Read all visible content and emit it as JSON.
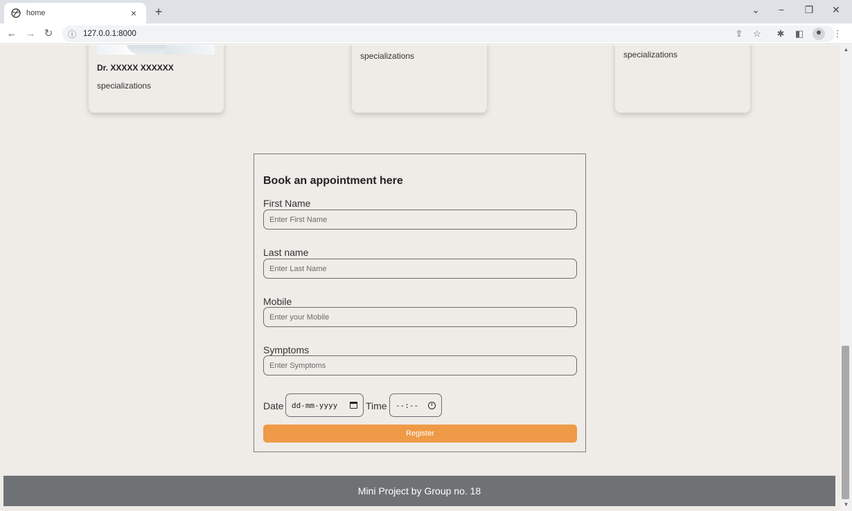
{
  "browser": {
    "tab_title": "home",
    "tab_close": "×",
    "new_tab": "+",
    "url": "127.0.0.1:8000",
    "icons": [
      "globe-icon",
      "back-icon",
      "forward-icon",
      "reload-icon",
      "info-icon",
      "share-icon",
      "star-icon",
      "extensions-icon",
      "side-panel-icon",
      "profile-icon",
      "menu-icon"
    ],
    "window_controls": {
      "dropdown": "⌄",
      "minimize": "−",
      "restore": "❐",
      "close": "✕"
    }
  },
  "doctors": [
    {
      "name": "Dr. XXXXX XXXXXX",
      "specialization": "specializations"
    },
    {
      "specialization": "specializations"
    },
    {
      "specialization": "specializations"
    }
  ],
  "appointment_form": {
    "title": "Book an appointment here",
    "fields": [
      {
        "label": "First Name",
        "placeholder": "Enter First Name"
      },
      {
        "label": "Last name",
        "placeholder": "Enter Last Name"
      },
      {
        "label": "Mobile",
        "placeholder": "Enter your Mobile"
      },
      {
        "label": "Symptoms",
        "placeholder": "Enter Symptoms"
      }
    ],
    "date_label": "Date",
    "date_placeholder": "dd-mm-yyyy",
    "time_label": "Time",
    "time_placeholder": "--:--",
    "submit_label": "Register",
    "accent_color": "#ee9a47"
  },
  "footer": {
    "text": "Mini Project by Group no. 18"
  },
  "colors": {
    "page_background": "#efebe7",
    "footer_background": "#6f7275"
  }
}
